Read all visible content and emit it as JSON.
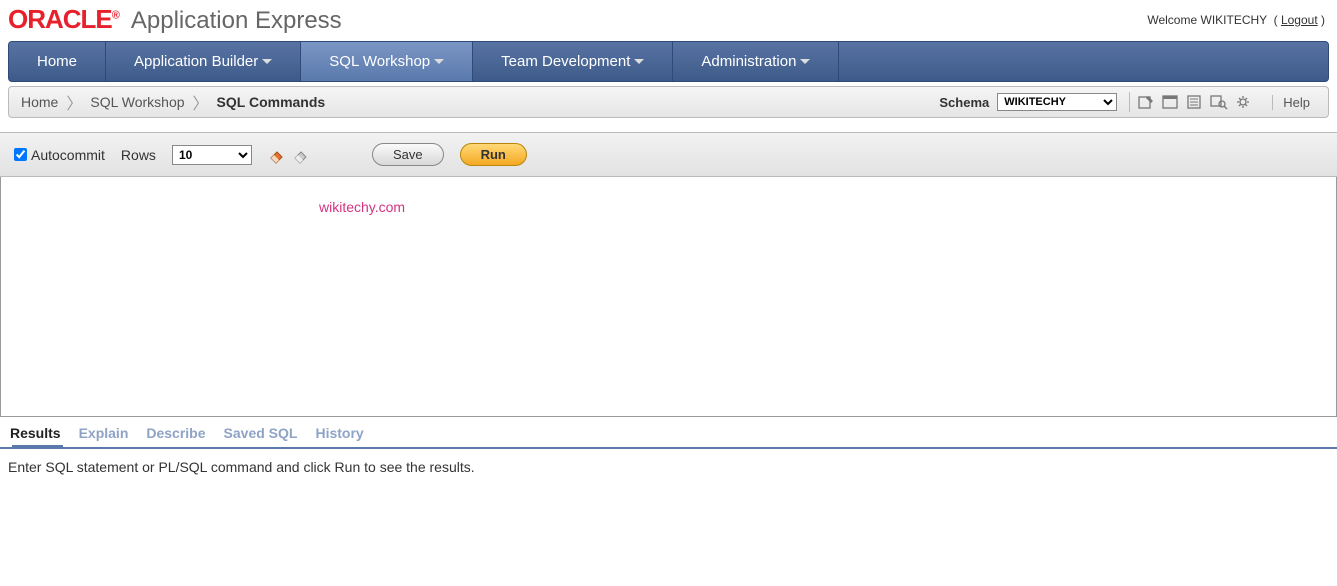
{
  "header": {
    "logo": "ORACLE",
    "app_title": "Application Express",
    "welcome_prefix": "Welcome ",
    "username": "WIKITECHY",
    "logout": "Logout"
  },
  "nav": {
    "items": [
      {
        "label": "Home",
        "caret": false,
        "active": false
      },
      {
        "label": "Application Builder",
        "caret": true,
        "active": false
      },
      {
        "label": "SQL Workshop",
        "caret": true,
        "active": true
      },
      {
        "label": "Team Development",
        "caret": true,
        "active": false
      },
      {
        "label": "Administration",
        "caret": true,
        "active": false
      }
    ]
  },
  "breadcrumb": {
    "items": [
      {
        "label": "Home",
        "current": false
      },
      {
        "label": "SQL Workshop",
        "current": false
      },
      {
        "label": "SQL Commands",
        "current": true
      }
    ],
    "schema_label": "Schema",
    "schema_value": "WIKITECHY",
    "help": "Help"
  },
  "controlbar": {
    "autocommit_label": "Autocommit",
    "autocommit_checked": true,
    "rows_label": "Rows",
    "rows_value": "10",
    "save_label": "Save",
    "run_label": "Run"
  },
  "editor": {
    "content": "",
    "watermark": "wikitechy.com"
  },
  "results": {
    "tabs": [
      {
        "label": "Results",
        "active": true
      },
      {
        "label": "Explain",
        "active": false
      },
      {
        "label": "Describe",
        "active": false
      },
      {
        "label": "Saved SQL",
        "active": false
      },
      {
        "label": "History",
        "active": false
      }
    ],
    "message": "Enter SQL statement or PL/SQL command and click Run to see the results."
  }
}
